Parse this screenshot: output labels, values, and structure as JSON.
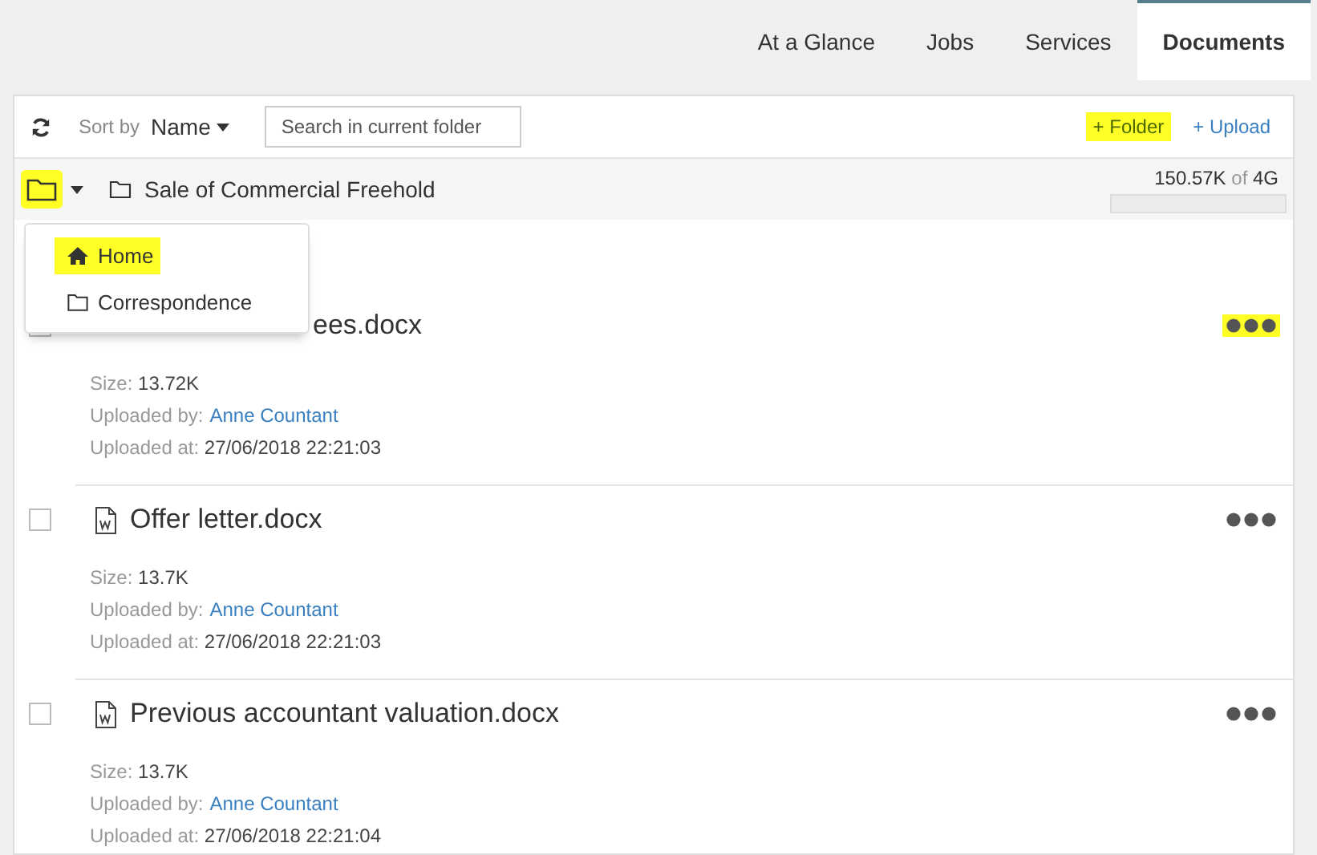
{
  "tabs": [
    {
      "label": "At a Glance",
      "selected": false
    },
    {
      "label": "Jobs",
      "selected": false
    },
    {
      "label": "Services",
      "selected": false
    },
    {
      "label": "Documents",
      "selected": true
    }
  ],
  "toolbar": {
    "sort_label": "Sort by",
    "sort_value": "Name",
    "search": {
      "placeholder": "Search in current folder"
    },
    "add_folder": {
      "label": "+ Folder",
      "highlighted": true
    },
    "upload": {
      "label": "+ Upload",
      "highlighted": false
    }
  },
  "breadcrumb": {
    "folder_button_highlighted": true,
    "path": "Sale of Commercial Freehold",
    "storage": {
      "used": "150.57K",
      "of": "of",
      "total": "4G",
      "level": 0.0
    }
  },
  "folder_menu": [
    {
      "label": "Home",
      "kind": "home",
      "highlighted": true
    },
    {
      "label": "Correspondence",
      "kind": "folder",
      "highlighted": false
    }
  ],
  "files": [
    {
      "name": "ees.docx",
      "covered": true,
      "checked": false,
      "menu_highlighted": true,
      "size_label": "Size:",
      "size": "13.72K",
      "by_label": "Uploaded by:",
      "by": "Anne Countant",
      "at_label": "Uploaded at:",
      "at": "27/06/2018 22:21:03"
    },
    {
      "name": "Offer letter.docx",
      "checked": false,
      "menu_highlighted": false,
      "size_label": "Size:",
      "size": "13.7K",
      "by_label": "Uploaded by:",
      "by": "Anne Countant",
      "at_label": "Uploaded at:",
      "at": "27/06/2018 22:21:03"
    },
    {
      "name": "Previous accountant valuation.docx",
      "checked": false,
      "menu_highlighted": false,
      "size_label": "Size:",
      "size": "13.7K",
      "by_label": "Uploaded by:",
      "by": "Anne Countant",
      "at_label": "Uploaded at:",
      "at": "27/06/2018 22:21:04"
    }
  ]
}
